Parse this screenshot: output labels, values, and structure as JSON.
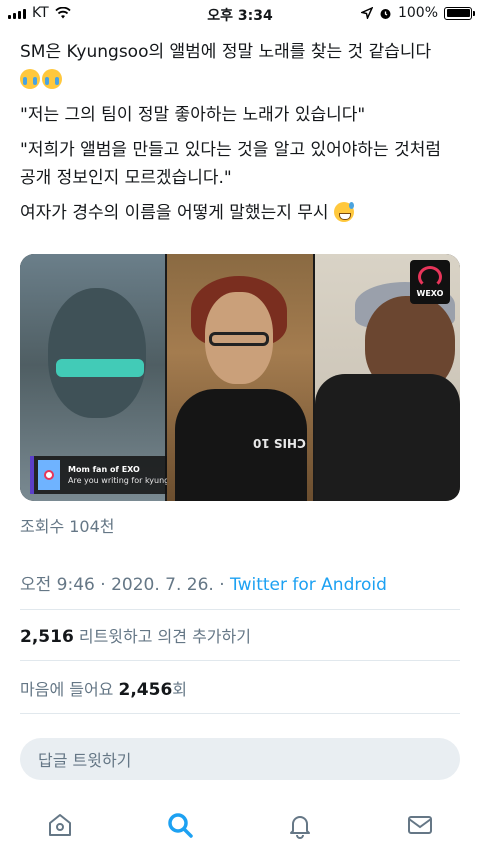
{
  "status_bar": {
    "carrier": "KT",
    "time": "오후 3:34",
    "battery": "100%"
  },
  "tweet": {
    "lines": [
      "SM은 Kyungsoo의 앨범에 정말 노래를 찾는 것 같습니다",
      "\"저는 그의 팀이 정말 좋아하는 노래가 있습니다\"",
      "\"저희가 앨범을 만들고 있다는 것을 알고 있어야하는 것처럼 공개 정보인지 모르겠습니다.\"",
      "여자가 경수의 이름을 어떻게 말했는지 무시"
    ],
    "emojis": [
      "loudly-crying-face",
      "loudly-crying-face",
      "grinning-sweat-face"
    ]
  },
  "media": {
    "logo_text": "WEXO",
    "shirt_text": "CHIS 10",
    "comment_name": "Mom fan of EXO",
    "comment_body": "Are you writing for kyungsoo?"
  },
  "views": "조회수 104천",
  "timestamp": {
    "time": "오전 9:46 · 2020. 7. 26. · ",
    "source": "Twitter for Android"
  },
  "stats": {
    "retweets_count": "2,516",
    "retweets_label": " 리트윗하고 의견 추가하기",
    "likes_label": "마음에 들어요 ",
    "likes_count": "2,456",
    "likes_suffix": "회"
  },
  "reply": {
    "placeholder": "답글 트윗하기"
  },
  "tabs": [
    "home",
    "search",
    "notifications",
    "messages"
  ],
  "colors": {
    "accent": "#1da1f2",
    "text": "#14171a",
    "muted": "#657786"
  }
}
